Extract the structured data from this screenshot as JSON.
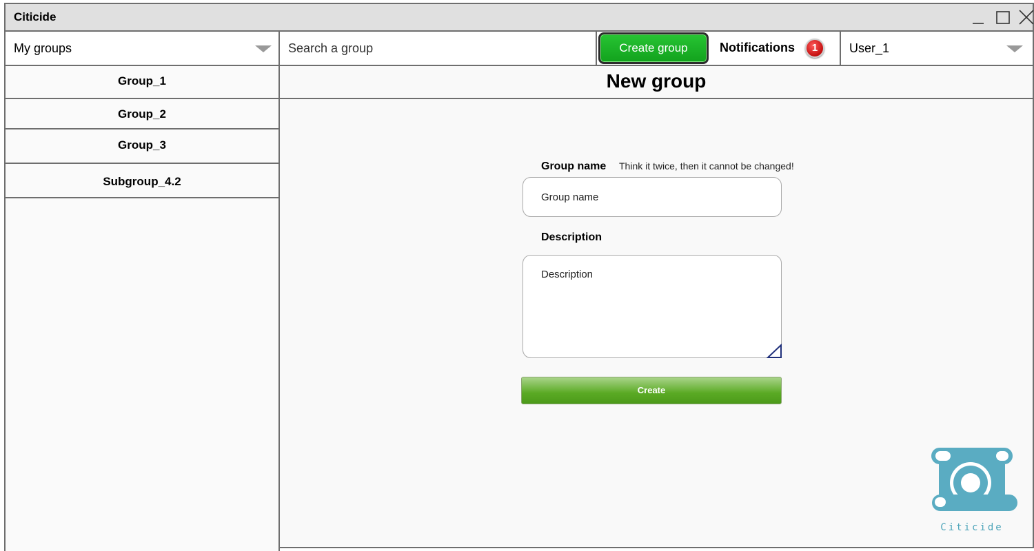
{
  "window": {
    "title": "Citicide",
    "controls": [
      "minimize-icon",
      "maximize-icon",
      "close-icon"
    ]
  },
  "toolbar": {
    "groups_dropdown": {
      "selected": "My groups"
    },
    "search": {
      "placeholder": "Search a group"
    },
    "create_group_label": "Create group",
    "notifications": {
      "label": "Notifications",
      "count": "1"
    },
    "user_dropdown": {
      "selected": "User_1"
    }
  },
  "sidebar": {
    "items": [
      {
        "label": "Group_1"
      },
      {
        "label": "Group_2"
      },
      {
        "label": "Group_3"
      },
      {
        "label": "Subgroup_4.2"
      }
    ]
  },
  "main": {
    "title": "New group",
    "form": {
      "group_name_label": "Group name",
      "group_name_hint": "Think it twice, then it cannot be changed!",
      "group_name_placeholder": "Group name",
      "description_label": "Description",
      "description_placeholder": "Description",
      "submit_label": "Create"
    },
    "logo_text": "Citicide"
  },
  "colors": {
    "accent_green": "#12a21d",
    "submit_green": "#5aaa24",
    "badge_red": "#c41010",
    "logo_teal": "#4aa3b8",
    "border_gray": "#6e6e6e"
  }
}
